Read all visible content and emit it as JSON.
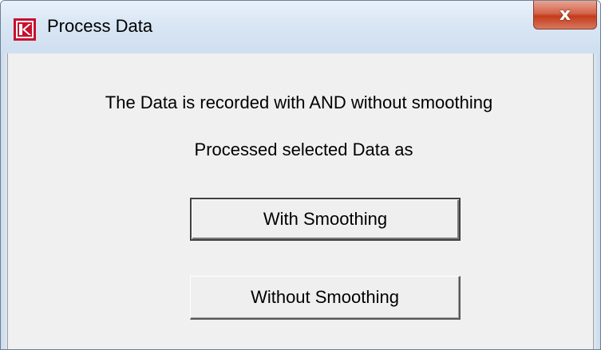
{
  "window": {
    "title": "Process Data",
    "close_glyph": "x",
    "icon": "k-logo-icon",
    "accent_color": "#c8102e"
  },
  "dialog": {
    "message_line_1": "The Data is recorded with AND without smoothing",
    "message_line_2": "Processed selected Data as",
    "buttons": {
      "with_smoothing": "With Smoothing",
      "without_smoothing": "Without Smoothing"
    }
  }
}
